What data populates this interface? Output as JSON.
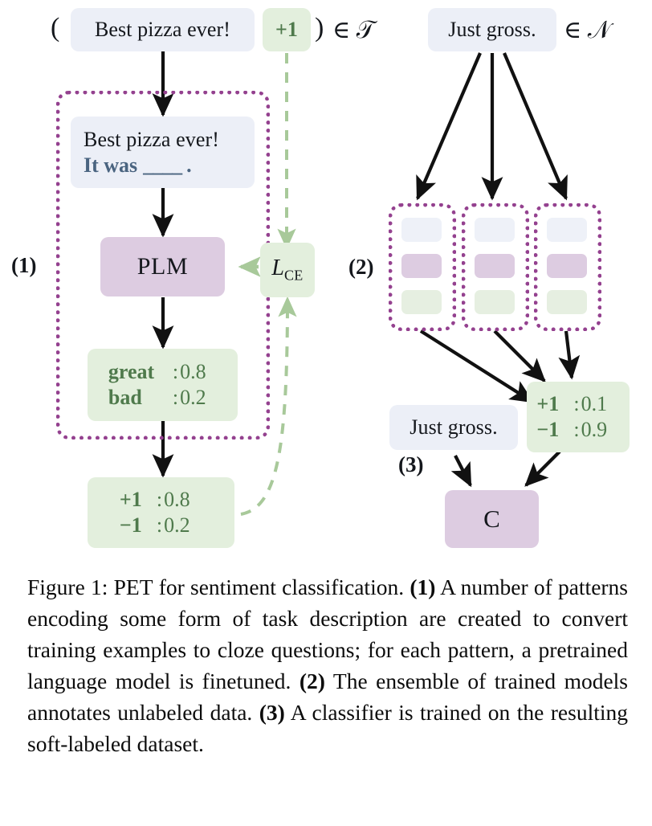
{
  "figure": {
    "train_example": {
      "open_paren": "(",
      "text": "Best pizza ever!",
      "label": "+1",
      "close_paren": ")",
      "membership": "∈ 𝒯"
    },
    "unlabeled_example": {
      "text": "Just gross.",
      "membership": "∈ 𝒩"
    },
    "step_labels": {
      "one": "(1)",
      "two": "(2)",
      "three": "(3)"
    },
    "cloze_box": {
      "line1": "Best pizza ever!",
      "line2_prefix": "It was",
      "line2_blank": "____",
      "line2_period": "."
    },
    "plm": {
      "label": "PLM"
    },
    "loss": {
      "label": "L",
      "subscript": "CE"
    },
    "verbalizer": {
      "rows": [
        {
          "key": "great",
          "sep": ":",
          "value": "0.8"
        },
        {
          "key": "bad",
          "sep": ":",
          "value": "0.2"
        }
      ]
    },
    "train_distribution": {
      "rows": [
        {
          "key": "+1",
          "sep": ":",
          "value": "0.8"
        },
        {
          "key": "−1",
          "sep": ":",
          "value": "0.2"
        }
      ]
    },
    "soft_label": {
      "rows": [
        {
          "key": "+1",
          "sep": ":",
          "value": "0.1"
        },
        {
          "key": "−1",
          "sep": ":",
          "value": "0.9"
        }
      ]
    },
    "soft_example": {
      "text": "Just gross."
    },
    "classifier": {
      "label": "C"
    },
    "ensembles": [
      {
        "cells": [
          "blue",
          "purple",
          "green"
        ]
      },
      {
        "cells": [
          "blue",
          "purple",
          "green"
        ]
      },
      {
        "cells": [
          "blue",
          "purple",
          "green"
        ]
      }
    ],
    "colors": {
      "blue_box": "#eceff7",
      "green_box": "#e3efdd",
      "purple_box": "#ddcce1",
      "green_text": "#4f7a4c",
      "cloze_text": "#4a6480",
      "dotted_purple": "#94418f",
      "dashed_green": "#a8c99a",
      "arrow_black": "#111111"
    }
  },
  "caption": {
    "prefix": "Figure 1:",
    "method": "PET",
    "t1": " for sentiment classification. ",
    "s1": "(1)",
    "t2": " A number of patterns encoding some form of task description are created to convert training examples to cloze questions; for each pattern, a pretrained language model is finetuned. ",
    "s2": "(2)",
    "t3": " The ensemble of trained models annotates unlabeled data. ",
    "s3": "(3)",
    "t4": " A classifier is trained on the resulting soft-labeled dataset."
  }
}
